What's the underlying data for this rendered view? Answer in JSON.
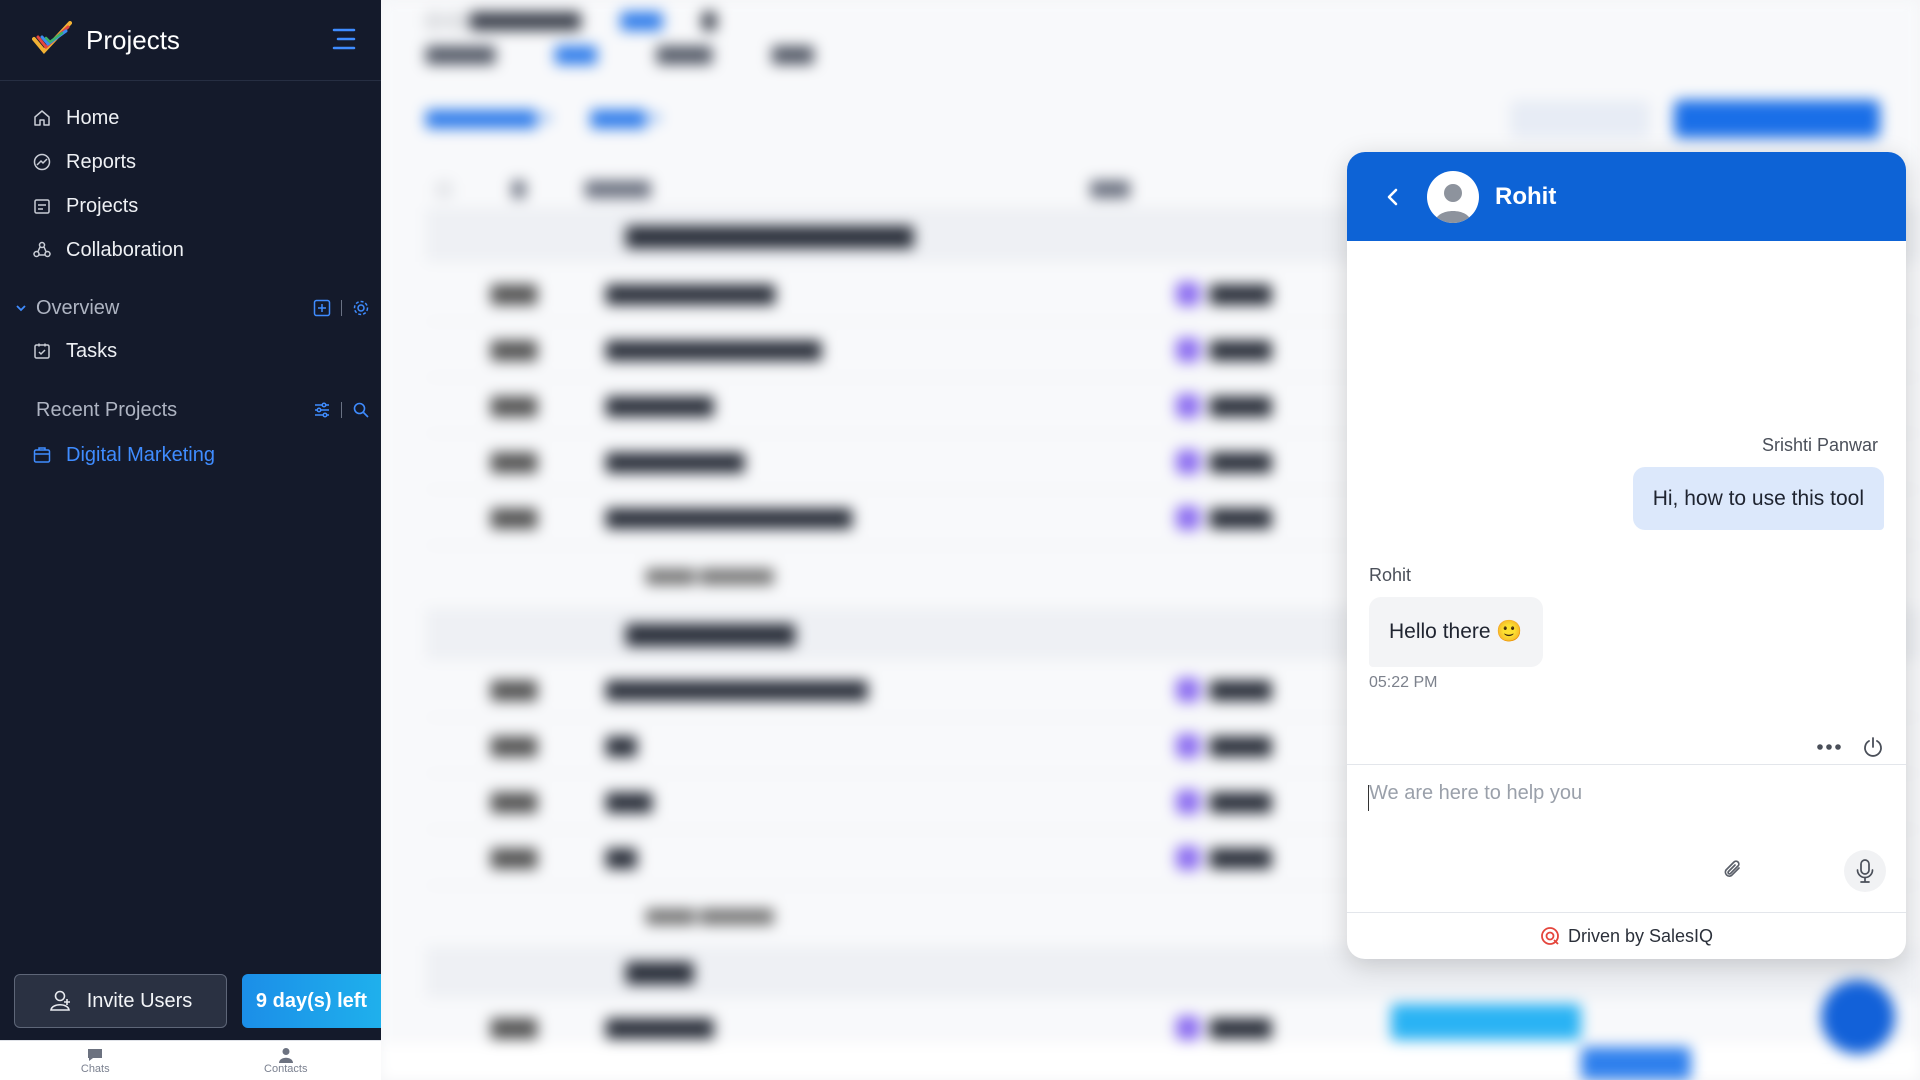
{
  "sidebar": {
    "brand": "Projects",
    "nav": [
      {
        "label": "Home",
        "icon": "home-icon"
      },
      {
        "label": "Reports",
        "icon": "reports-icon"
      },
      {
        "label": "Projects",
        "icon": "projects-icon"
      },
      {
        "label": "Collaboration",
        "icon": "collaboration-icon"
      }
    ],
    "overview": {
      "title": "Overview",
      "items": [
        {
          "label": "Tasks",
          "icon": "tasks-icon"
        }
      ]
    },
    "recent": {
      "title": "Recent Projects",
      "items": [
        {
          "label": "Digital Marketing",
          "icon": "project-folder-icon",
          "active": true
        }
      ]
    },
    "invite_label": "Invite Users",
    "trial_label": "9 day(s) left"
  },
  "bottom_tabs": [
    {
      "label": "Chats",
      "icon": "chat-bubble-icon"
    },
    {
      "label": "Contacts",
      "icon": "contact-person-icon"
    }
  ],
  "chat": {
    "agent_name": "Rohit",
    "messages": [
      {
        "sender": "Srishti Panwar",
        "text": "Hi, how to use this tool",
        "side": "me"
      },
      {
        "sender": "Rohit",
        "text": "Hello there 🙂",
        "side": "them",
        "time": "05:22 PM"
      }
    ],
    "input_placeholder": "We are here to help you",
    "footer": "Driven by SalesIQ"
  },
  "colors": {
    "sidebar_bg": "#141a2b",
    "accent": "#3f8cff",
    "chat_header": "#0d63d6",
    "trial_button": "#1b8ee8"
  }
}
